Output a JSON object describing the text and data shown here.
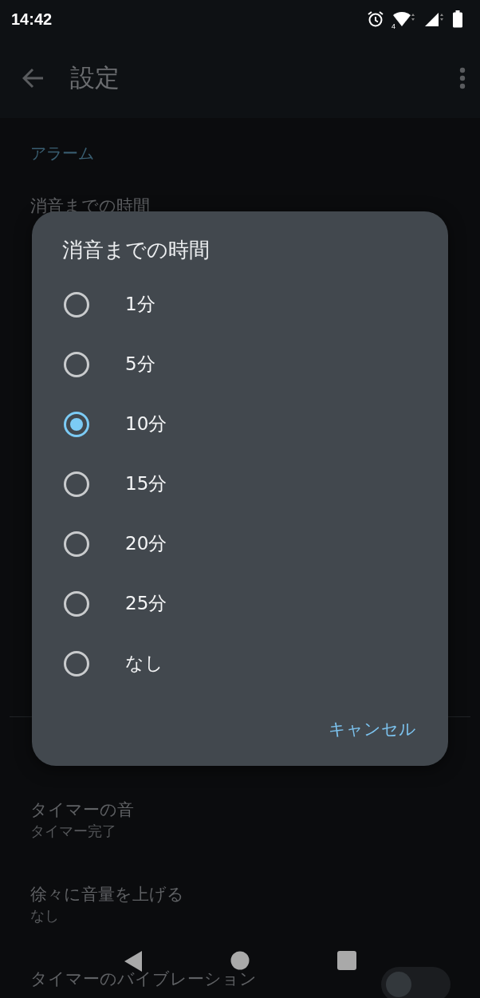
{
  "status_bar": {
    "time": "14:42",
    "wifi_badge": "4"
  },
  "app_bar": {
    "title": "設定"
  },
  "sections": [
    {
      "header": "アラーム",
      "items": [
        {
          "title": "消音までの時間"
        }
      ]
    },
    {
      "items": [
        {
          "title": "タイマーの音",
          "subtitle": "タイマー完了"
        },
        {
          "title": "徐々に音量を上げる",
          "subtitle": "なし"
        },
        {
          "title": "タイマーのバイブレーション",
          "kind": "toggle",
          "on": false
        }
      ]
    }
  ],
  "dialog": {
    "title": "消音までの時間",
    "options": [
      {
        "label": "1分",
        "selected": false
      },
      {
        "label": "5分",
        "selected": false
      },
      {
        "label": "10分",
        "selected": true
      },
      {
        "label": "15分",
        "selected": false
      },
      {
        "label": "20分",
        "selected": false
      },
      {
        "label": "25分",
        "selected": false
      },
      {
        "label": "なし",
        "selected": false
      }
    ],
    "cancel": "キャンセル"
  }
}
